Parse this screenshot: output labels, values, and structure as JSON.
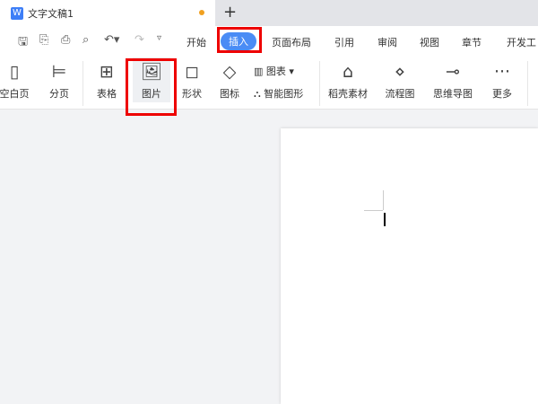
{
  "tab": {
    "title": "文字文稿1",
    "logo": "W",
    "new_tab": "+"
  },
  "quick_access": [
    "save-icon",
    "export-pdf-icon",
    "print-icon",
    "print-preview-icon",
    "undo-icon",
    "redo-icon",
    "customize-icon"
  ],
  "menu": [
    {
      "label": "开始"
    },
    {
      "label": "插入",
      "active": true
    },
    {
      "label": "页面布局"
    },
    {
      "label": "引用"
    },
    {
      "label": "审阅"
    },
    {
      "label": "视图"
    },
    {
      "label": "章节"
    },
    {
      "label": "开发工"
    }
  ],
  "ribbon": {
    "blank_page": "空白页",
    "page_break": "分页",
    "table": "表格",
    "picture": "图片",
    "shape": "形状",
    "icon": "图标",
    "chart": "图表",
    "smart_art": "智能图形",
    "daoke": "稻壳素材",
    "flowchart": "流程图",
    "mindmap": "思维导图",
    "more": "更多"
  },
  "colors": {
    "accent": "#4a8cf5",
    "highlight": "#e00000",
    "unsaved_dot": "#f0a020"
  }
}
